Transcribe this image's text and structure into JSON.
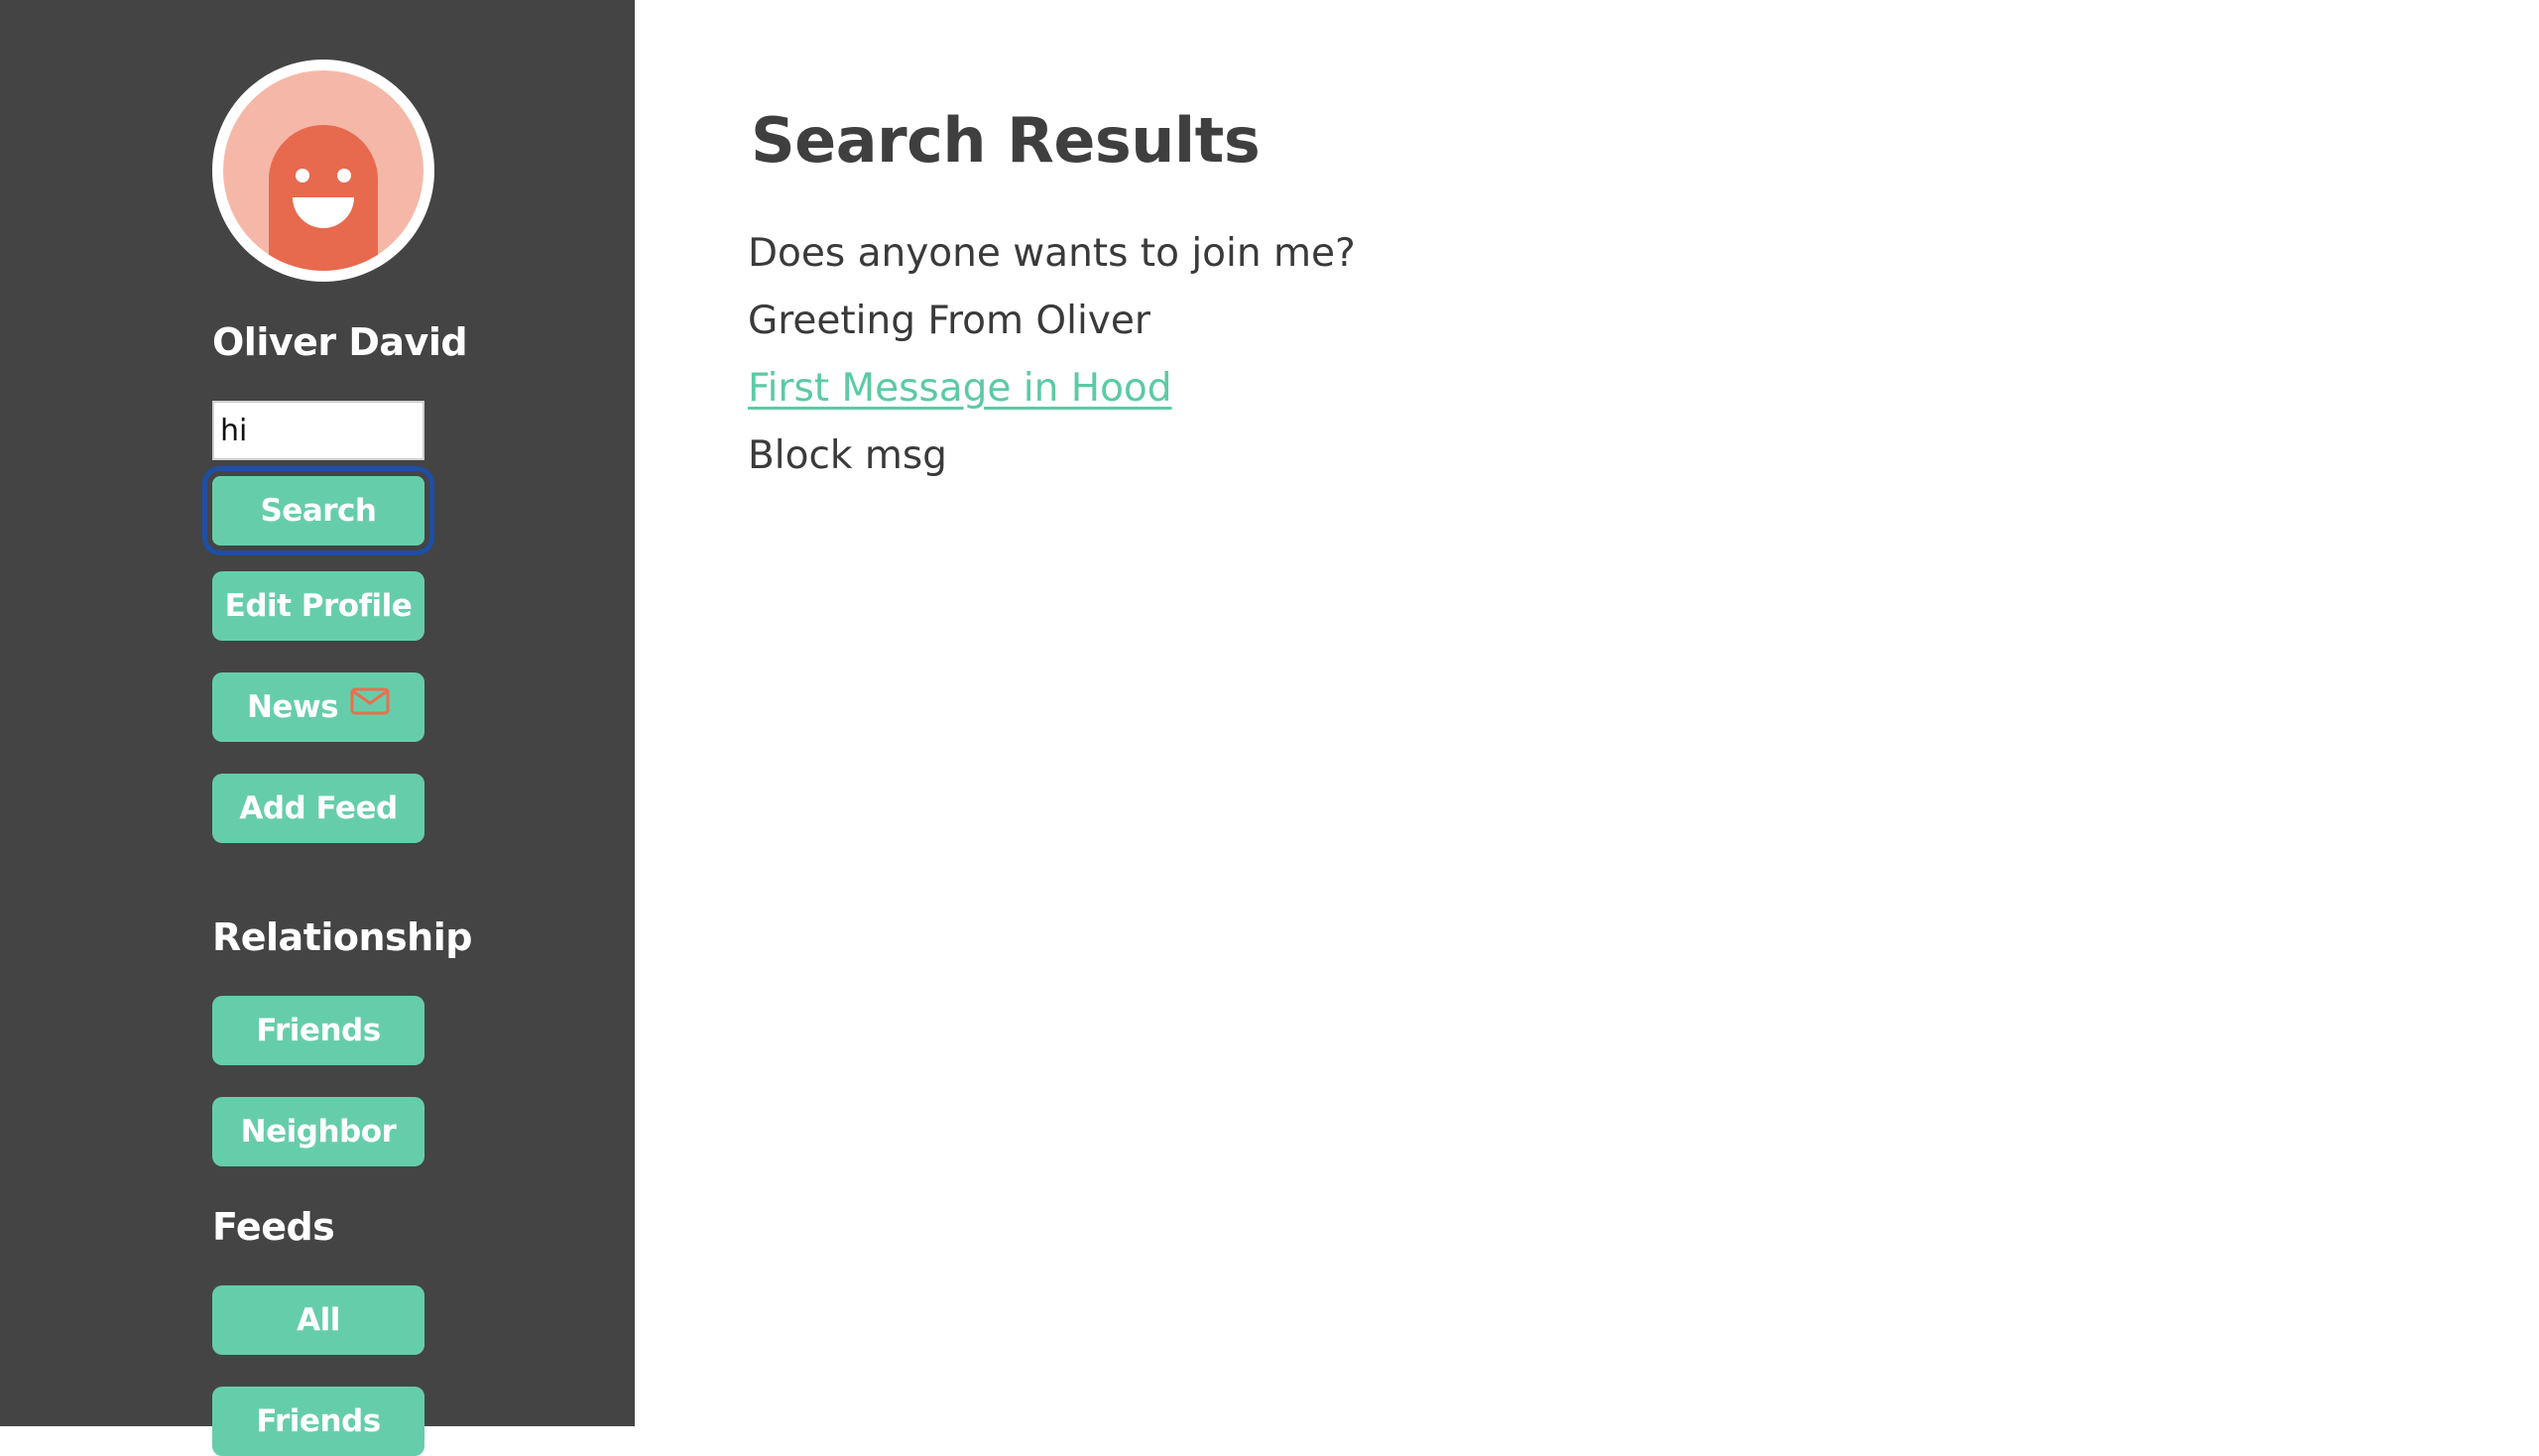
{
  "colors": {
    "sidebar_bg": "#444444",
    "accent": "#66cdab",
    "link": "#5ccaa5",
    "avatar_bg": "#f5b8a8",
    "avatar_figure": "#e86a4e",
    "mail_icon": "#e8704f",
    "focus_ring": "#1d4fa6"
  },
  "sidebar": {
    "avatar_icon": "smiley-avatar-icon",
    "user_name": "Oliver David",
    "search": {
      "value": "hi",
      "placeholder": "",
      "button_label": "Search"
    },
    "buttons": {
      "edit_profile": "Edit Profile",
      "news": "News",
      "news_icon": "mail-icon",
      "add_feed": "Add Feed"
    },
    "relationship": {
      "title": "Relationship",
      "items": [
        "Friends",
        "Neighbor"
      ]
    },
    "feeds": {
      "title": "Feeds",
      "items": [
        "All",
        "Friends"
      ]
    }
  },
  "main": {
    "title": "Search Results",
    "results": [
      {
        "text": "Does anyone wants to join me?",
        "link": false
      },
      {
        "text": "Greeting From Oliver",
        "link": false
      },
      {
        "text": "First Message in Hood",
        "link": true
      },
      {
        "text": "Block msg",
        "link": false
      }
    ]
  }
}
